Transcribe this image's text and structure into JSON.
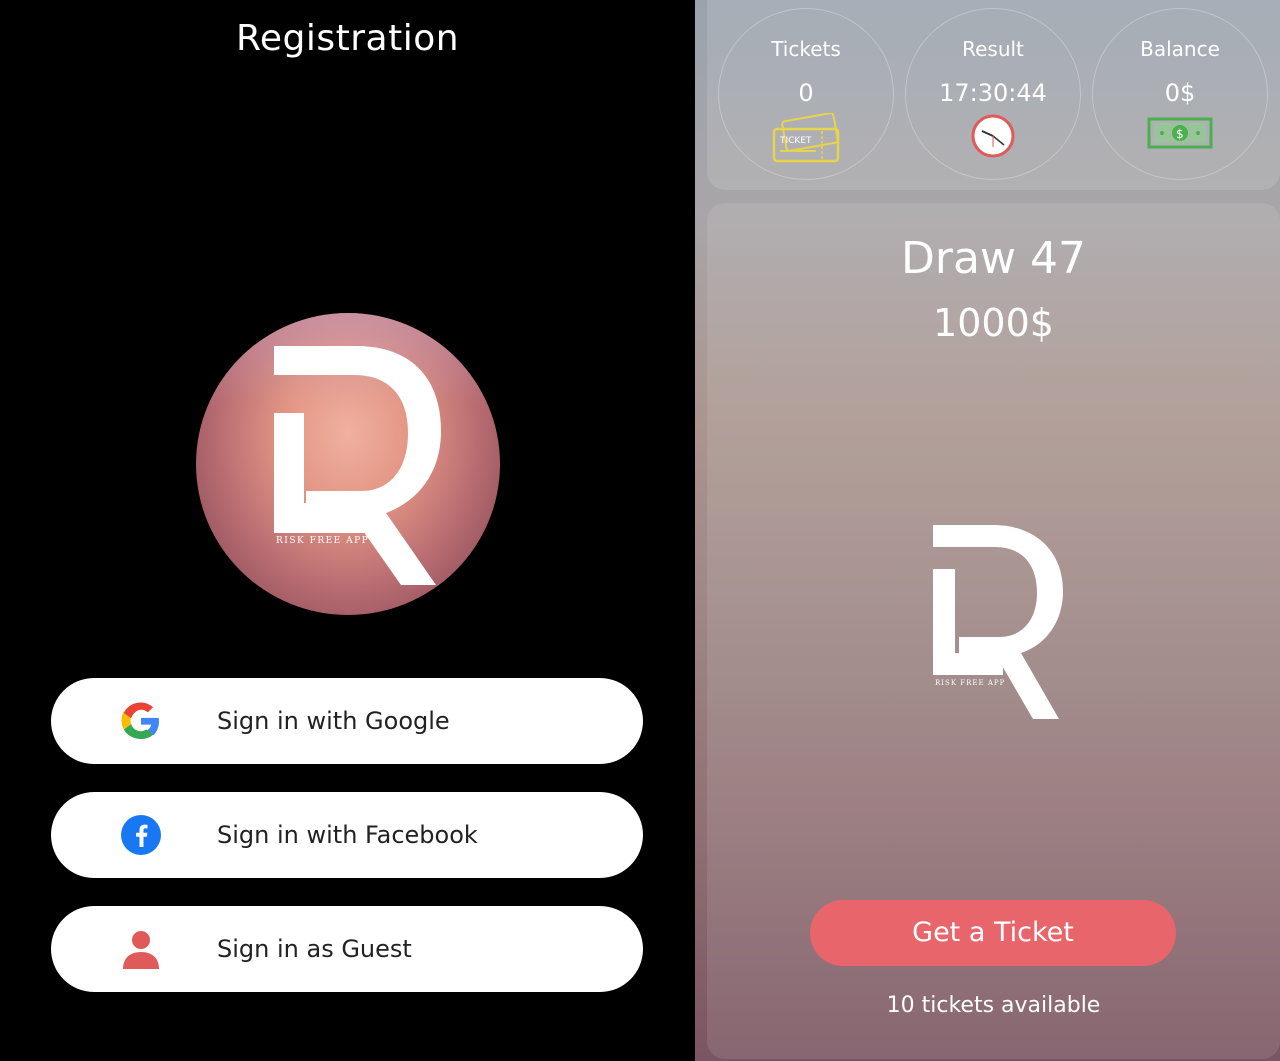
{
  "registration": {
    "title": "Registration",
    "logo_caption": "RISK FREE APP",
    "buttons": {
      "google": {
        "label": "Sign in with Google",
        "icon": "google-icon"
      },
      "facebook": {
        "label": "Sign in with Facebook",
        "icon": "facebook-icon"
      },
      "guest": {
        "label": "Sign in as Guest",
        "icon": "guest-user-icon"
      }
    }
  },
  "dashboard": {
    "stats": {
      "tickets": {
        "label": "Tickets",
        "value": "0",
        "icon": "ticket-icon"
      },
      "result": {
        "label": "Result",
        "value": "17:30:44",
        "icon": "clock-icon"
      },
      "balance": {
        "label": "Balance",
        "value": "0$",
        "icon": "dollar-bill-icon"
      }
    },
    "ticket_icon_text": "TICKET",
    "draw": {
      "title": "Draw 47",
      "prize": "1000$",
      "logo_caption": "RISK FREE APP"
    },
    "get_ticket_label": "Get a Ticket",
    "tickets_available": "10 tickets available"
  },
  "colors": {
    "accent_button": "#e8666b",
    "facebook_blue": "#1877f2",
    "guest_red": "#e05a5a",
    "ticket_yellow": "#e8d44a",
    "money_green": "#4caf50"
  }
}
